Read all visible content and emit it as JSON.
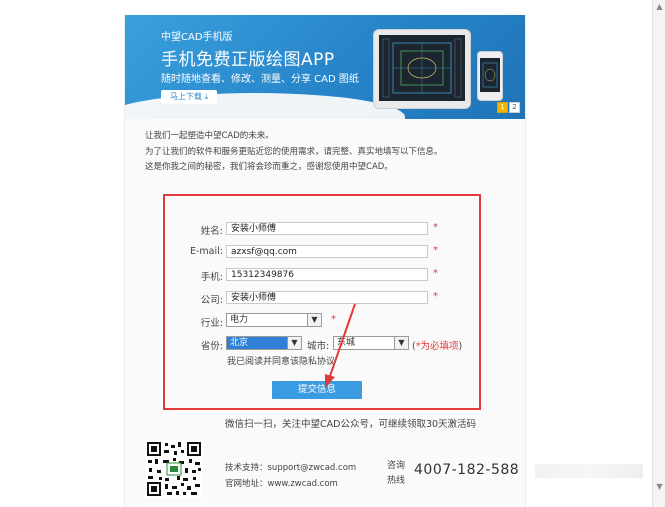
{
  "banner": {
    "brand": "中望CAD手机版",
    "title": "手机免费正版绘图APP",
    "subtitle": "随时随地查看、修改、测量、分享 CAD 图纸",
    "download_label": "马上下载 ⤓",
    "pages": [
      "1",
      "2"
    ]
  },
  "intro": [
    "让我们一起塑造中望CAD的未来。",
    "为了让我们的软件和服务更贴近您的使用需求，请完整、真实地填写以下信息。",
    "这是你我之间的秘密，我们将会珍而重之，感谢您使用中望CAD。"
  ],
  "form": {
    "name_label": "姓名:",
    "name_value": "安装小师傅",
    "email_label": "E-mail:",
    "email_value": "azxsf@qq.com",
    "phone_label": "手机:",
    "phone_value": "15312349876",
    "company_label": "公司:",
    "company_value": "安装小师傅",
    "industry_label": "行业:",
    "industry_value": "电力",
    "province_label": "省份:",
    "province_value": "北京",
    "city_label": "城市:",
    "city_value": "东城",
    "required_mark": "*",
    "required_note_open": "(",
    "required_note": "*为必填项",
    "required_note_close": ")",
    "agree_text": "我已阅读并同意该隐私协议",
    "submit_label": "提交信息"
  },
  "footer": {
    "wechat_text": "微信扫一扫，关注中望CAD公众号，可继续领取30天激活码",
    "support": "技术支持：support@zwcad.com",
    "website": "官网地址：www.zwcad.com",
    "hotline_label_1": "咨询",
    "hotline_label_2": "热线",
    "hotline_number": "4007-182-588"
  },
  "colors": {
    "banner_blue": "#2684c9",
    "highlight_red": "#e23a3a",
    "submit_blue": "#3b9be0"
  }
}
